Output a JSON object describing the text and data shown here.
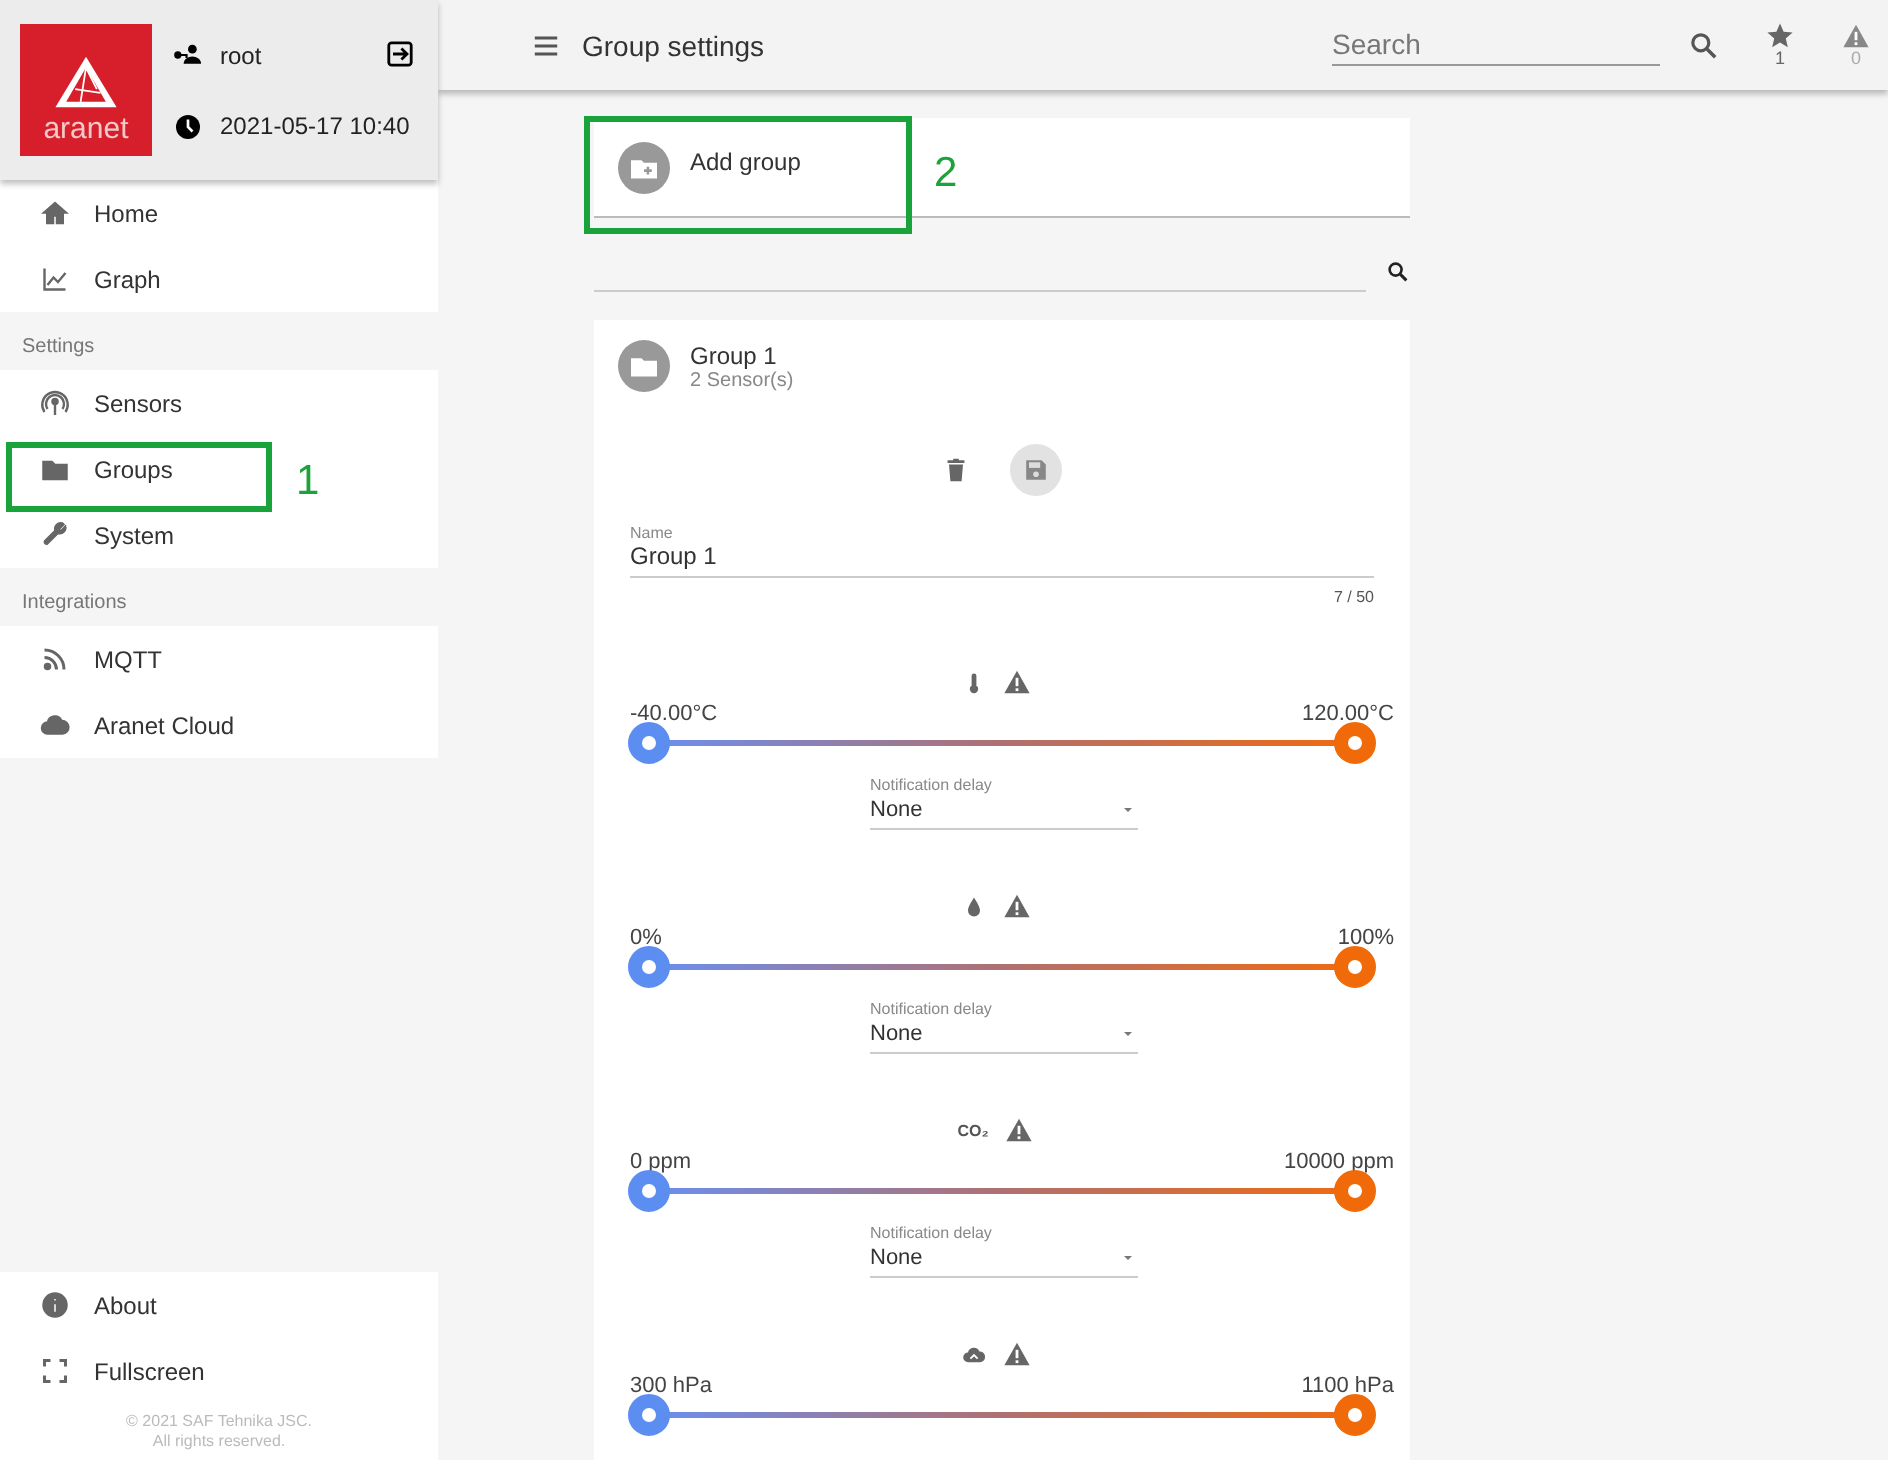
{
  "sidebar": {
    "logo": {
      "text": "aranet"
    },
    "user": "root",
    "datetime": "2021-05-17 10:40",
    "sections": [
      {
        "items": [
          {
            "label": "Home",
            "kind": "home"
          },
          {
            "label": "Graph",
            "kind": "graph"
          }
        ]
      },
      {
        "title": "Settings",
        "items": [
          {
            "label": "Sensors",
            "kind": "sensors"
          },
          {
            "label": "Groups",
            "kind": "groups"
          },
          {
            "label": "System",
            "kind": "system"
          }
        ]
      },
      {
        "title": "Integrations",
        "items": [
          {
            "label": "MQTT",
            "kind": "mqtt"
          },
          {
            "label": "Aranet Cloud",
            "kind": "cloud"
          }
        ]
      }
    ],
    "bottom_items": [
      {
        "label": "About",
        "kind": "about"
      },
      {
        "label": "Fullscreen",
        "kind": "fullscreen"
      }
    ],
    "copyright": [
      "© 2021 SAF Tehnika JSC.",
      "All rights reserved."
    ]
  },
  "topbar": {
    "title": "Group settings",
    "search": {
      "placeholder": "Search"
    },
    "favorites_count": "1",
    "alerts_count": "0"
  },
  "add_group": {
    "label": "Add group"
  },
  "group": {
    "name": "Group 1",
    "sensors": "2 Sensor(s)",
    "name_field": {
      "label": "Name",
      "value": "Group 1",
      "counter": "7 / 50"
    },
    "thresholds": [
      {
        "kind": "temperature",
        "min": "-40.00°C",
        "max": "120.00°C",
        "thumbs": [
          {
            "level": 0
          },
          {
            "level": 1
          }
        ],
        "delay": {
          "label": "Notification delay",
          "value": "None"
        }
      },
      {
        "kind": "humidity",
        "min": "0%",
        "max": "100%",
        "thumbs": [
          {
            "level": 0
          },
          {
            "level": 1
          }
        ],
        "delay": {
          "label": "Notification delay",
          "value": "None"
        }
      },
      {
        "kind": "co2",
        "symbol": "CO₂",
        "min": "0 ppm",
        "max": "10000 ppm",
        "thumbs": [
          {
            "level": 0
          },
          {
            "level": 1
          }
        ],
        "delay": {
          "label": "Notification delay",
          "value": "None"
        }
      },
      {
        "kind": "pressure",
        "min": "300 hPa",
        "max": "1100 hPa",
        "thumbs": [
          {
            "level": 0
          },
          {
            "level": 1
          }
        ]
      }
    ]
  },
  "annotations": [
    {
      "kind": "groups",
      "label": "1"
    },
    {
      "kind": "add_group",
      "label": "2"
    }
  ]
}
